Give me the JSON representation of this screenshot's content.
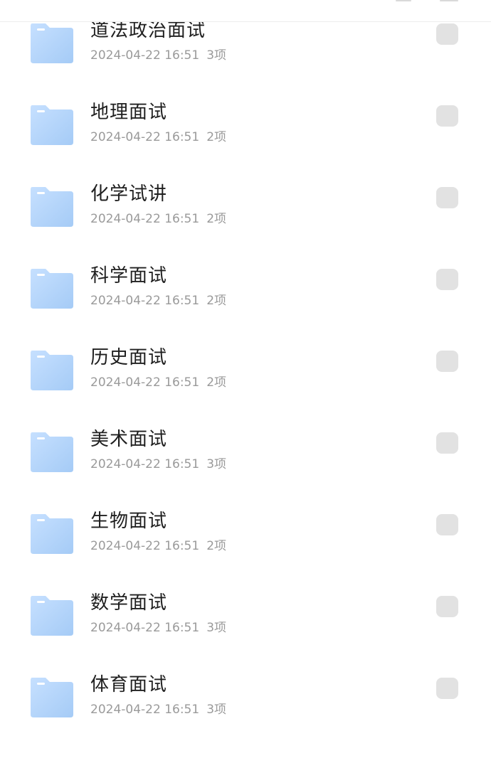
{
  "folders": [
    {
      "name": "道法政治面试",
      "date": "2024-04-22 16:51",
      "count": "3项"
    },
    {
      "name": "地理面试",
      "date": "2024-04-22 16:51",
      "count": "2项"
    },
    {
      "name": "化学试讲",
      "date": "2024-04-22 16:51",
      "count": "2项"
    },
    {
      "name": "科学面试",
      "date": "2024-04-22 16:51",
      "count": "2项"
    },
    {
      "name": "历史面试",
      "date": "2024-04-22 16:51",
      "count": "2项"
    },
    {
      "name": "美术面试",
      "date": "2024-04-22 16:51",
      "count": "3项"
    },
    {
      "name": "生物面试",
      "date": "2024-04-22 16:51",
      "count": "2项"
    },
    {
      "name": "数学面试",
      "date": "2024-04-22 16:51",
      "count": "3项"
    },
    {
      "name": "体育面试",
      "date": "2024-04-22 16:51",
      "count": "3项"
    }
  ],
  "icons": {
    "folder": "folder-icon",
    "checkbox": "checkbox-unchecked"
  },
  "colors": {
    "folder_light": "#c6e0ff",
    "folder_dark": "#a5cbf6",
    "checkbox": "#e2e2e2",
    "title_text": "#1f1f1f",
    "meta_text": "#9a9a9a"
  }
}
